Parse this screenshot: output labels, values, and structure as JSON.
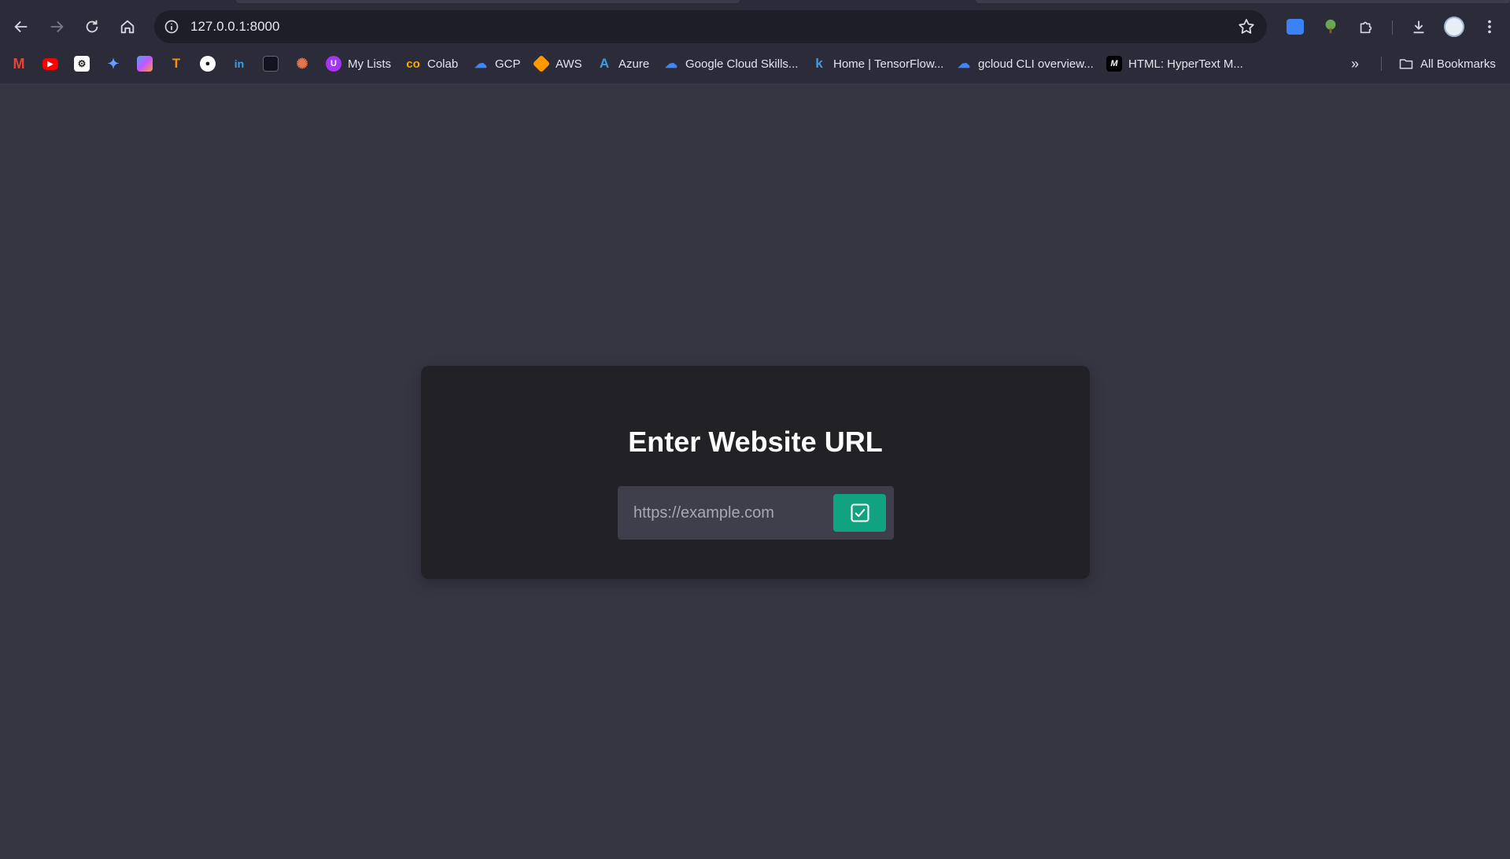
{
  "browser": {
    "address_bar": {
      "url": "127.0.0.1:8000"
    },
    "bookmarks": [
      {
        "label": "",
        "icon": "gmail-icon"
      },
      {
        "label": "",
        "icon": "youtube-icon"
      },
      {
        "label": "",
        "icon": "chatgpt-icon"
      },
      {
        "label": "",
        "icon": "gemini-icon"
      },
      {
        "label": "",
        "icon": "copilot-icon"
      },
      {
        "label": "",
        "icon": "tensorflow-icon"
      },
      {
        "label": "",
        "icon": "github-icon"
      },
      {
        "label": "",
        "icon": "linkedin-icon"
      },
      {
        "label": "",
        "icon": "app-icon"
      },
      {
        "label": "",
        "icon": "claude-icon"
      },
      {
        "label": "My Lists",
        "icon": "udemy-icon"
      },
      {
        "label": "Colab",
        "icon": "colab-icon"
      },
      {
        "label": "GCP",
        "icon": "google-cloud-icon"
      },
      {
        "label": "AWS",
        "icon": "aws-icon"
      },
      {
        "label": "Azure",
        "icon": "azure-icon"
      },
      {
        "label": "Google Cloud Skills...",
        "icon": "google-cloud-icon"
      },
      {
        "label": "Home | TensorFlow...",
        "icon": "keras-icon"
      },
      {
        "label": "gcloud CLI overview...",
        "icon": "google-cloud-icon"
      },
      {
        "label": "HTML: HyperText M...",
        "icon": "mdn-icon"
      }
    ],
    "all_bookmarks_label": "All Bookmarks"
  },
  "page": {
    "heading": "Enter Website URL",
    "url_input": {
      "placeholder": "https://example.com",
      "value": ""
    },
    "submit_icon": "check-square-icon",
    "accent_color": "#11a37f"
  }
}
